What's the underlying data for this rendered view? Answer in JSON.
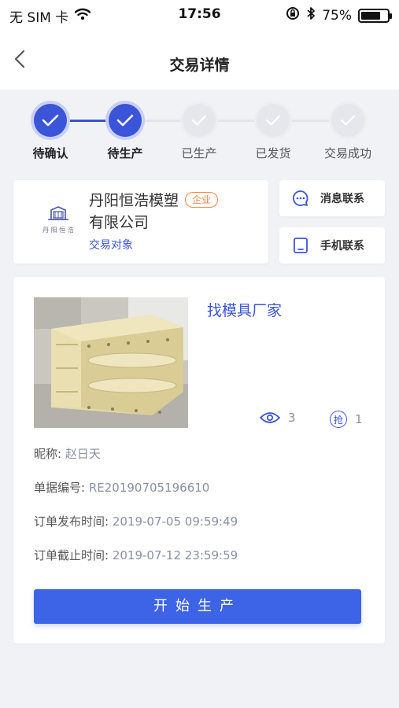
{
  "status_bar": {
    "carrier": "无 SIM 卡",
    "time": "17:56",
    "battery_text": "75%",
    "battery_level": 0.75
  },
  "nav": {
    "title": "交易详情",
    "back_icon": "chevron-left-icon"
  },
  "steps": [
    {
      "label": "待确认",
      "state": "done"
    },
    {
      "label": "待生产",
      "state": "done"
    },
    {
      "label": "已生产",
      "state": "todo"
    },
    {
      "label": "已发货",
      "state": "todo"
    },
    {
      "label": "交易成功",
      "state": "todo"
    }
  ],
  "company": {
    "name_line1": "丹阳恒浩模塑",
    "name_line2": "有限公司",
    "badge": "企业",
    "subtitle": "交易对象",
    "logo_text": "丹阳恒浩"
  },
  "contacts": {
    "message_label": "消息联系",
    "phone_label": "手机联系"
  },
  "order": {
    "title": "找模具厂家",
    "views": "3",
    "grabs": "1",
    "grab_icon_char": "抢",
    "nickname_label": "昵称:",
    "nickname_value": "赵日天",
    "order_no_label": "单据编号:",
    "order_no_value": "RE20190705196610",
    "publish_label": "订单发布时间:",
    "publish_value": "2019-07-05 09:59:49",
    "deadline_label": "订单截止时间:",
    "deadline_value": "2019-07-12 23:59:59",
    "start_button": "开始生产"
  },
  "colors": {
    "accent": "#3c54d8",
    "button": "#3d63e6",
    "badge": "#f0884a",
    "background": "#f1f2f6"
  }
}
